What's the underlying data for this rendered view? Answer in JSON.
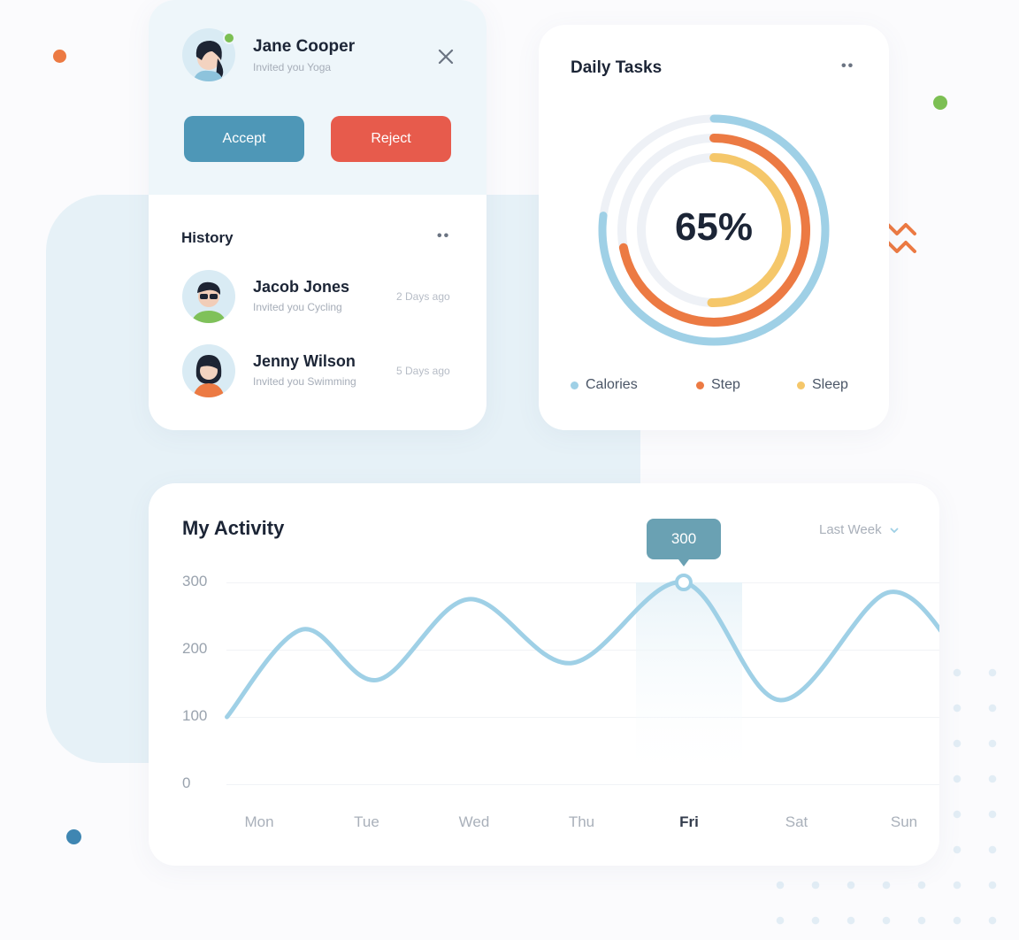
{
  "invite": {
    "name": "Jane Cooper",
    "subtitle": "Invited you Yoga",
    "close_icon": "close-icon",
    "accept_label": "Accept",
    "reject_label": "Reject",
    "accept_color": "#4e97b7",
    "reject_color": "#e75b4c"
  },
  "history": {
    "title": "History",
    "items": [
      {
        "name": "Jacob Jones",
        "subtitle": "Invited you Cycling",
        "time": "2 Days ago"
      },
      {
        "name": "Jenny Wilson",
        "subtitle": "Invited you Swimming",
        "time": "5 Days ago"
      }
    ]
  },
  "tasks": {
    "title": "Daily Tasks",
    "percent": "65%",
    "legend": [
      {
        "label": "Calories",
        "color": "#9fd0e6"
      },
      {
        "label": "Step",
        "color": "#ec7a43"
      },
      {
        "label": "Sleep",
        "color": "#f5c76a"
      }
    ]
  },
  "activity": {
    "title": "My Activity",
    "filter": "Last Week",
    "tooltip": "300"
  },
  "chart_data": {
    "type": "line",
    "title": "My Activity",
    "categories": [
      "Mon",
      "Tue",
      "Wed",
      "Thu",
      "Fri",
      "Sat",
      "Sun"
    ],
    "y_ticks": [
      "300",
      "200",
      "100",
      "0"
    ],
    "ylim": [
      0,
      300
    ],
    "highlight": "Fri",
    "series": [
      {
        "values": [
          100,
          230,
          155,
          275,
          180,
          300,
          125,
          285,
          195
        ],
        "x": [
          -0.3,
          0.4,
          1.1,
          1.95,
          2.9,
          3.95,
          4.85,
          5.85,
          6.5
        ]
      }
    ],
    "line_color": "#9fd0e6"
  }
}
